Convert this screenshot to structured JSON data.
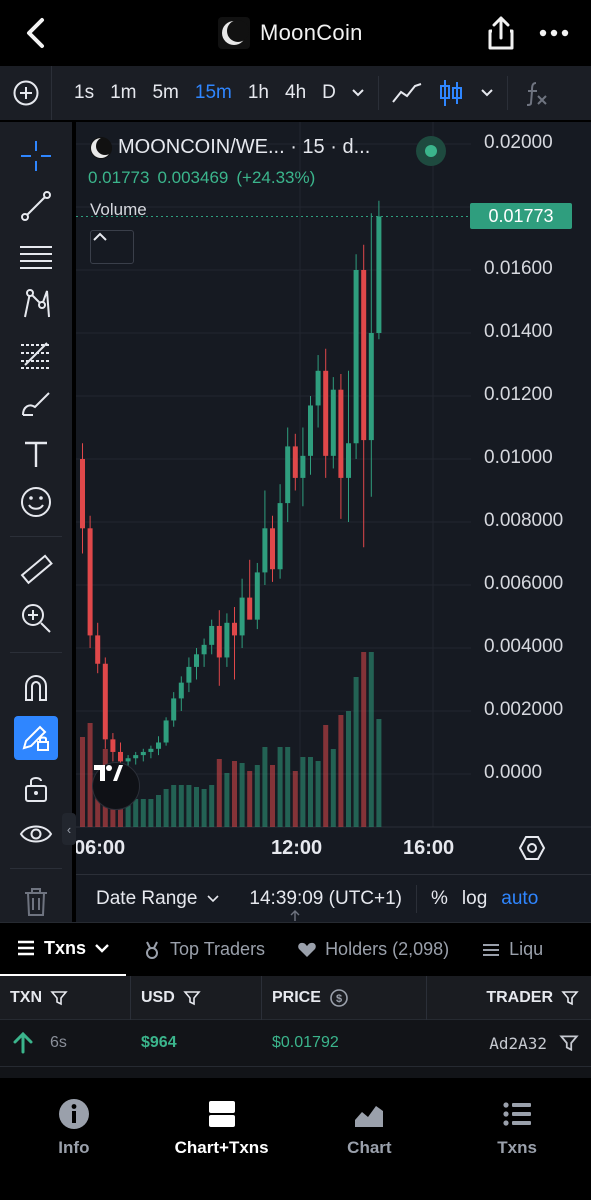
{
  "header": {
    "title": "MoonCoin"
  },
  "timeframes": {
    "items": [
      "1s",
      "1m",
      "5m",
      "15m",
      "1h",
      "4h",
      "D"
    ],
    "active": "15m"
  },
  "chart_header": {
    "symbol": "MOONCOIN/WE... · 15 · d...",
    "price": "0.01773",
    "change": "0.003469",
    "change_pct": "(+24.33%)",
    "volume_label": "Volume",
    "last_price_tag": "0.01773"
  },
  "chart_data": {
    "type": "candlestick",
    "title": "MOONCOIN/WE... · 15 · d...",
    "y_ticks": [
      "0.02000",
      "0.01600",
      "0.01400",
      "0.01200",
      "0.01000",
      "0.008000",
      "0.006000",
      "0.004000",
      "0.002000",
      "0.0000"
    ],
    "ylim": [
      0,
      0.02
    ],
    "x_ticks": [
      "06:00",
      "12:00",
      "16:00"
    ],
    "candles": [
      {
        "o": 0.01,
        "h": 0.0105,
        "l": 0.007,
        "c": 0.0078
      },
      {
        "o": 0.0078,
        "h": 0.0082,
        "l": 0.004,
        "c": 0.0044
      },
      {
        "o": 0.0044,
        "h": 0.0048,
        "l": 0.0032,
        "c": 0.0035
      },
      {
        "o": 0.0035,
        "h": 0.0037,
        "l": 0.0008,
        "c": 0.0011
      },
      {
        "o": 0.0011,
        "h": 0.0013,
        "l": 0.0004,
        "c": 0.0007
      },
      {
        "o": 0.0007,
        "h": 0.001,
        "l": 0.0003,
        "c": 0.0004
      },
      {
        "o": 0.0004,
        "h": 0.0006,
        "l": 0.0001,
        "c": 0.0005
      },
      {
        "o": 0.0005,
        "h": 0.0007,
        "l": 0.0003,
        "c": 0.0006
      },
      {
        "o": 0.0006,
        "h": 0.0008,
        "l": 0.0004,
        "c": 0.0007
      },
      {
        "o": 0.0007,
        "h": 0.0009,
        "l": 0.0005,
        "c": 0.0008
      },
      {
        "o": 0.0008,
        "h": 0.0012,
        "l": 0.0006,
        "c": 0.001
      },
      {
        "o": 0.001,
        "h": 0.0018,
        "l": 0.0009,
        "c": 0.0017
      },
      {
        "o": 0.0017,
        "h": 0.0026,
        "l": 0.0015,
        "c": 0.0024
      },
      {
        "o": 0.0024,
        "h": 0.0031,
        "l": 0.002,
        "c": 0.0029
      },
      {
        "o": 0.0029,
        "h": 0.0037,
        "l": 0.0026,
        "c": 0.0034
      },
      {
        "o": 0.0034,
        "h": 0.004,
        "l": 0.003,
        "c": 0.0038
      },
      {
        "o": 0.0038,
        "h": 0.0043,
        "l": 0.0034,
        "c": 0.0041
      },
      {
        "o": 0.0041,
        "h": 0.0049,
        "l": 0.0038,
        "c": 0.0047
      },
      {
        "o": 0.0047,
        "h": 0.0052,
        "l": 0.0028,
        "c": 0.0037
      },
      {
        "o": 0.0037,
        "h": 0.0051,
        "l": 0.0034,
        "c": 0.0048
      },
      {
        "o": 0.0048,
        "h": 0.0053,
        "l": 0.003,
        "c": 0.0044
      },
      {
        "o": 0.0044,
        "h": 0.0062,
        "l": 0.004,
        "c": 0.0056
      },
      {
        "o": 0.0056,
        "h": 0.0068,
        "l": 0.005,
        "c": 0.0049
      },
      {
        "o": 0.0049,
        "h": 0.0067,
        "l": 0.0046,
        "c": 0.0064
      },
      {
        "o": 0.0064,
        "h": 0.009,
        "l": 0.006,
        "c": 0.0078
      },
      {
        "o": 0.0078,
        "h": 0.0082,
        "l": 0.0061,
        "c": 0.0065
      },
      {
        "o": 0.0065,
        "h": 0.0092,
        "l": 0.0062,
        "c": 0.0086
      },
      {
        "o": 0.0086,
        "h": 0.011,
        "l": 0.008,
        "c": 0.0104
      },
      {
        "o": 0.0104,
        "h": 0.0108,
        "l": 0.009,
        "c": 0.0094
      },
      {
        "o": 0.0094,
        "h": 0.011,
        "l": 0.0085,
        "c": 0.0101
      },
      {
        "o": 0.0101,
        "h": 0.012,
        "l": 0.0095,
        "c": 0.0117
      },
      {
        "o": 0.0117,
        "h": 0.0133,
        "l": 0.011,
        "c": 0.0128
      },
      {
        "o": 0.0128,
        "h": 0.0135,
        "l": 0.0094,
        "c": 0.0101
      },
      {
        "o": 0.0101,
        "h": 0.0126,
        "l": 0.0097,
        "c": 0.0122
      },
      {
        "o": 0.0122,
        "h": 0.0127,
        "l": 0.0081,
        "c": 0.0094
      },
      {
        "o": 0.0094,
        "h": 0.0128,
        "l": 0.008,
        "c": 0.0105
      },
      {
        "o": 0.0105,
        "h": 0.0165,
        "l": 0.01,
        "c": 0.016
      },
      {
        "o": 0.016,
        "h": 0.0168,
        "l": 0.0072,
        "c": 0.0106
      },
      {
        "o": 0.0106,
        "h": 0.0178,
        "l": 0.0088,
        "c": 0.014
      },
      {
        "o": 0.014,
        "h": 0.0182,
        "l": 0.0138,
        "c": 0.0177
      }
    ]
  },
  "chart_bottom": {
    "date_range": "Date Range",
    "time": "14:39:09 (UTC+1)",
    "pct": "%",
    "log": "log",
    "auto": "auto"
  },
  "txn_tabs": [
    {
      "label": "Txns",
      "active": true
    },
    {
      "label": "Top Traders"
    },
    {
      "label": "Holders (2,098)"
    },
    {
      "label": "Liqu"
    }
  ],
  "table": {
    "columns": [
      "TXN",
      "USD",
      "PRICE",
      "TRADER"
    ],
    "rows": [
      {
        "age": "6s",
        "usd": "$964",
        "price": "$0.01792",
        "trader": "Ad2A32"
      }
    ]
  },
  "bottom_nav": [
    {
      "label": "Info"
    },
    {
      "label": "Chart+Txns",
      "active": true
    },
    {
      "label": "Chart"
    },
    {
      "label": "Txns"
    }
  ],
  "colors": {
    "up": "#2f9e7e",
    "down": "#e0484a",
    "accent": "#2f86ff"
  }
}
